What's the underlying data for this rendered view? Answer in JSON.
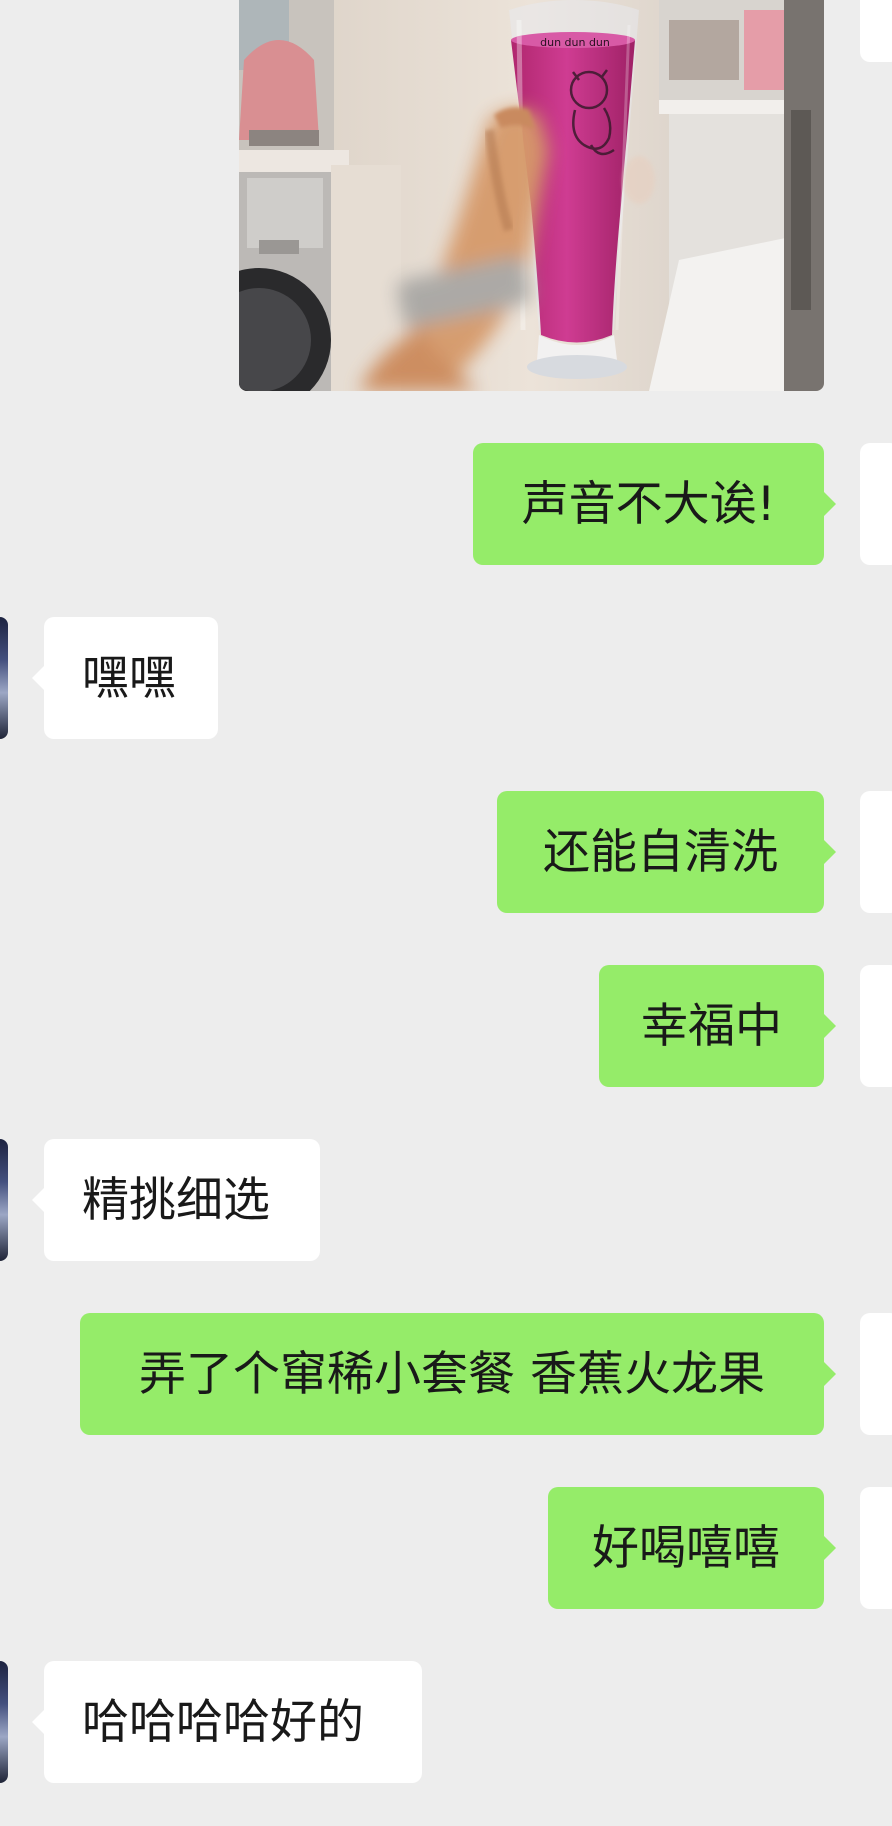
{
  "photo": {
    "cup_print_text": "dun dun dun"
  },
  "messages": [
    {
      "side": "right",
      "text": "声音不大诶!"
    },
    {
      "side": "left",
      "text": "嘿嘿"
    },
    {
      "side": "right",
      "text": "还能自清洗"
    },
    {
      "side": "right",
      "text": "幸福中"
    },
    {
      "side": "left",
      "text": "精挑细选"
    },
    {
      "side": "right",
      "text": "弄了个窜稀小套餐 香蕉火龙果"
    },
    {
      "side": "right",
      "text": "好喝嘻嘻"
    },
    {
      "side": "left",
      "text": "哈哈哈哈好的"
    }
  ],
  "colors": {
    "background": "#ededed",
    "outgoing_bubble": "#95ec69",
    "incoming_bubble": "#ffffff",
    "text": "#191919"
  }
}
